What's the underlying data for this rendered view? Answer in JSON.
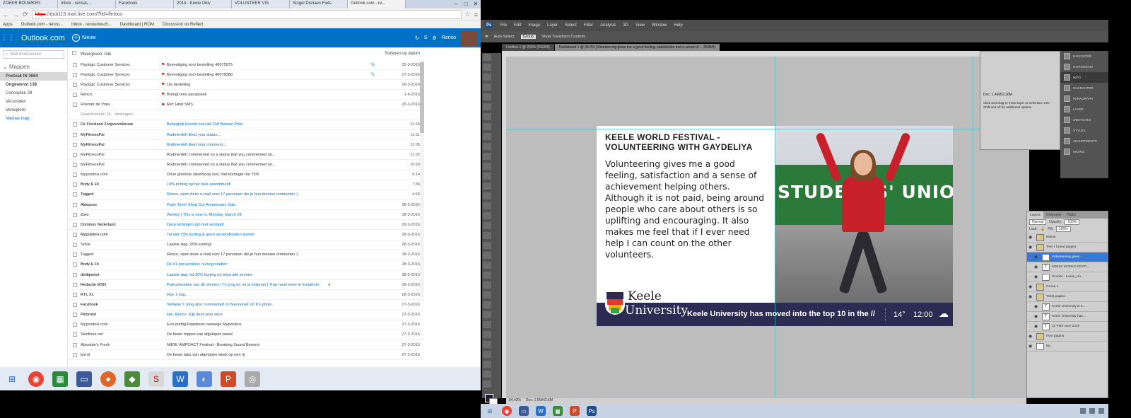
{
  "browser": {
    "tabs": [
      "ZOEKR BOUWKEN",
      "Inbox - rensas...",
      "Facebook",
      "2014 - Keele Univ",
      "VOLUNTEER VIS",
      "Singel Disnaes Fiets",
      "Outlook.com - re..."
    ],
    "url": "https://dub115.mail.live.com/?fid=flinbox",
    "url_scheme": "https",
    "bookmarks": [
      "Apps",
      "Outlook.com - renou...",
      "Inbox - renoudouch...",
      "Dashboard | ROM",
      "Discussion on Reflect"
    ]
  },
  "outlook": {
    "title": "Outlook.com",
    "new_label": "Nieuw",
    "search_placeholder": "Mail doorzoeken",
    "folders_header": "Mappen",
    "folders": [
      {
        "label": "Postvak IN  3664",
        "selected": true,
        "bold": true
      },
      {
        "label": "Ongewenst  138",
        "bold": true
      },
      {
        "label": "Concepten  29"
      },
      {
        "label": "Verzonden"
      },
      {
        "label": "Verwijderd"
      },
      {
        "label": "Nieuwe map",
        "link": true
      }
    ],
    "filter_label": "Weergeven: Alle",
    "sort_label": "Sorteren op datum",
    "messages": [
      {
        "sender": "Paylogic Customer Services",
        "flag": true,
        "subject": "Bevestiging voor bestelling 40075975",
        "attach": true,
        "date": "22-3-2016",
        "unread": false
      },
      {
        "sender": "Paylogic Customer Services",
        "flag": true,
        "subject": "Bevestiging voor bestelling 40078388",
        "attach": true,
        "date": "27-3-2016",
        "unread": false
      },
      {
        "sender": "Paylogic Customer Services",
        "flag": true,
        "subject": "Uw bestelling",
        "attach": false,
        "date": "26-3-2016",
        "unread": false
      },
      {
        "sender": "Renco",
        "flag": true,
        "subject": "Brengt tens aanspreek",
        "attach": false,
        "date": "1-6-2016",
        "unread": false
      },
      {
        "sender": "Roemer de Vries",
        "flag": true,
        "subject": "Ref: Hind SMS",
        "attach": false,
        "date": "25-3-2016",
        "unread": false
      },
      {
        "sender": "Gearchiveerd: 16 · Verbergen",
        "flag": false,
        "subject": "",
        "attach": false,
        "date": "",
        "group": true
      },
      {
        "sender": "De Friesland Zorgverzekeraar",
        "flag": false,
        "subject": "Belangrijk bericht over de Zelf Bewust Polis",
        "attach": false,
        "date": "11:15",
        "unread": true
      },
      {
        "sender": "MyFitnessPal",
        "flag": false,
        "subject": "Rudmerdeh liked your status...",
        "attach": false,
        "date": "11:11",
        "unread": true
      },
      {
        "sender": "MyFitnessPal",
        "flag": false,
        "subject": "Rudmerdeh liked your comment...",
        "attach": false,
        "date": "11:05",
        "unread": true
      },
      {
        "sender": "MyFitnessPal",
        "flag": false,
        "subject": "Rudmerdeh commented on a status that you commented on...",
        "attach": false,
        "date": "11:02",
        "unread": false
      },
      {
        "sender": "MyFitnessPal",
        "flag": false,
        "subject": "Rudmerdeh commented on a status that you commented on...",
        "attach": false,
        "date": "10:59",
        "unread": false
      },
      {
        "sender": "Mypostinis.com",
        "flag": false,
        "subject": "Onze grootste uitverkoop ooit, met kortingen tot 75%",
        "attach": false,
        "date": "9:14",
        "unread": false
      },
      {
        "sender": "Body & Fit",
        "flag": false,
        "subject": "10% korting op het hele assortiment!",
        "attach": false,
        "date": "7:36",
        "unread": true
      },
      {
        "sender": "Tagged",
        "flag": false,
        "subject": "Renco, open deze e-mail voor 17 personen die je hun moeten ontmoeten :)",
        "attach": false,
        "date": "4:56",
        "unread": true
      },
      {
        "sender": "Aldeposs",
        "flag": false,
        "subject": "Party Time! Shop Our Anniversary Sale",
        "attach": false,
        "date": "28-3-2016",
        "unread": true
      },
      {
        "sender": "Zoro",
        "flag": false,
        "subject": "Weekly | This is new in, Monday, March 28",
        "attach": false,
        "date": "28-3-2016",
        "unread": true
      },
      {
        "sender": "Dominos Nederland",
        "flag": false,
        "subject": "Deze kortingen zijn niet verslapt!",
        "attach": false,
        "date": "29-3-2016",
        "unread": true
      },
      {
        "sender": "Mypostinis.com",
        "flag": false,
        "subject": "Tot wel 75% korting & geen verzendkosten wereld",
        "attach": false,
        "date": "28-3-2016",
        "unread": true
      },
      {
        "sender": "Smile",
        "flag": false,
        "subject": "Laatste dag: 20% korting!",
        "attach": false,
        "date": "28-3-2016",
        "unread": false
      },
      {
        "sender": "Tagged",
        "flag": false,
        "subject": "Renco, open deze e-mail voor 17 personen die je hun moeten ontmoeten :)",
        "attach": false,
        "date": "28-3-2016",
        "unread": false
      },
      {
        "sender": "Body & Fit",
        "flag": false,
        "subject": "De #1 pre-workout, nu nog sneller!",
        "attach": false,
        "date": "28-3-2016",
        "unread": true
      },
      {
        "sender": "delibjoeisrt",
        "flag": false,
        "subject": "Laatste dag: tot 20% korting op bijna alle serines",
        "attach": false,
        "date": "28-3-2016",
        "unread": true
      },
      {
        "sender": "Redactie MSN",
        "flag": false,
        "subject": "Paleoshoeden van de donnes | 7x jong en nu al miljonair | Trap nooit meer in foetafrom",
        "attach": false,
        "date": "28-3-2016",
        "unread": true,
        "dot": true
      },
      {
        "sender": "RTL XL",
        "flag": false,
        "subject": "Hoe 1 dag...",
        "attach": false,
        "date": "28-3-2016",
        "unread": true
      },
      {
        "sender": "Facebook",
        "flag": false,
        "subject": "Stefanie 't Jong also commented on Nanouneli Vd K's photo.",
        "attach": false,
        "date": "27-3-2016",
        "unread": true
      },
      {
        "sender": "Pinterest",
        "flag": false,
        "subject": "Hoi, Renco: Kijk deze pins eens",
        "attach": false,
        "date": "27-3-2016",
        "unread": true
      },
      {
        "sender": "Mypostinis.com",
        "flag": false,
        "subject": "Een prettig Paasfeest vanwege Mypostinis",
        "attach": false,
        "date": "27-3-2016",
        "unread": false
      },
      {
        "sender": "Skinfixes.net",
        "flag": false,
        "subject": "De beste toppes van afgelopen week!",
        "attach": false,
        "date": "27-3-2016",
        "unread": false
      },
      {
        "sender": "Absolute's Fresh",
        "flag": false,
        "subject": "NIEW: AMPOACT Festival - Breaking Sound Bement",
        "attach": false,
        "date": "27-3-2016",
        "unread": false
      },
      {
        "sender": "bol.nl",
        "flag": false,
        "subject": "De beste tabs van afgelopen week op een rij",
        "attach": false,
        "date": "27-3-2016",
        "unread": false
      }
    ]
  },
  "photoshop": {
    "menu": [
      "Ps",
      "File",
      "Edit",
      "Image",
      "Layer",
      "Select",
      "Filter",
      "Analysis",
      "3D",
      "View",
      "Window",
      "Help"
    ],
    "options": [
      "Auto-Select:",
      "Group",
      "Show Transform Controls"
    ],
    "doc_tabs": [
      "Untitled-1 @ 200% (RGB/8)",
      "Dashboard 1 @ 94.4% (Volunteering gives me a good feeling, satisfaction and a sense of ... RGB/8)"
    ],
    "zoom": "94.43%",
    "doc_size": "Doc: 1.5M/42.6M",
    "info_panel": {
      "doc": "Doc: 1.49M/2.26M",
      "hint": "Click and drag to move layer or selection. Use Shift and Alt for additional options."
    },
    "dock": [
      "NAVIGATOR",
      "HISTOGRAM",
      "INFO",
      "CHARACTER",
      "PARAGRAPH",
      "LAYER",
      "SWATCHES",
      "STYLES",
      "ADJUSTMENTS",
      "MASKS"
    ],
    "layers_tabs": [
      "Layers",
      "Channels",
      "Paths"
    ],
    "blend": "Normal",
    "opacity_label": "Opacity:",
    "opacity": "100%",
    "lock_label": "Lock:",
    "fill_label": "Fill:",
    "fill": "100%",
    "layers": [
      {
        "name": "Nieuw",
        "type": "folder",
        "indent": 0
      },
      {
        "name": "Text + brand pagina",
        "type": "folder",
        "indent": 0
      },
      {
        "name": "Volunteering gives...",
        "type": "text",
        "indent": 1,
        "selected": true
      },
      {
        "name": "KEELE WORLD FESTI...",
        "type": "text",
        "indent": 1
      },
      {
        "name": "Scoolio - Keele_Un...",
        "type": "image",
        "indent": 1
      },
      {
        "name": "Group 1",
        "type": "folder",
        "indent": 0
      },
      {
        "name": "Tekst pagina",
        "type": "folder",
        "indent": 0
      },
      {
        "name": "Keele University is a...",
        "type": "text",
        "indent": 1
      },
      {
        "name": "Keele University has...",
        "type": "text",
        "indent": 1
      },
      {
        "name": "22 Febr race 2016",
        "type": "text",
        "indent": 1
      },
      {
        "name": "Foto pagina",
        "type": "folder",
        "indent": 0
      },
      {
        "name": "Bg",
        "type": "image",
        "indent": 0
      }
    ]
  },
  "ad": {
    "title": "KEELE WORLD FESTIVAL - VOLUNTEERING WITH GAYDELIYA",
    "body": "Volunteering gives me a good feeling, satisfaction and a sense of achievement helping others. Although it is not paid, being around people who care about others is so uplifting and encouraging. It also makes me feel that if I ever need help I can count on the other volunteers.",
    "sign": "STUDENTS' UNIO",
    "logo_line1": "Keele",
    "logo_line2": "University",
    "ticker": "Keele University has moved into the top 10 in the //",
    "temp": "14°",
    "time": "12:00",
    "weather_icon": "partly-cloudy-icon"
  },
  "colors": {
    "outlook_blue": "#0072c6",
    "ad_navy": "#2c2c52",
    "sign_green": "#2b7a3a",
    "coat_red": "#c8202a"
  }
}
